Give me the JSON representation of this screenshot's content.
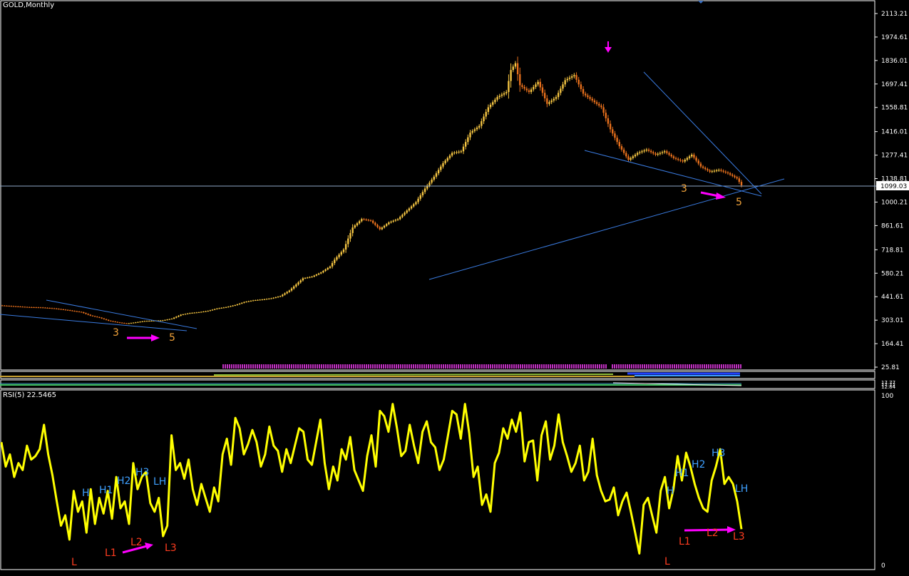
{
  "header": {
    "title": "GOLD,Monthly"
  },
  "colors": {
    "background": "#000000",
    "frame": "#ffffff",
    "bull_candle": "#f5c542",
    "bear_candle": "#e8701c",
    "trendline": "#3a7be0",
    "price_line": "#a0b8d8",
    "rsi_line": "#ffff00",
    "arrow": "#ff00ff",
    "wave_label": "#f2a33a",
    "high_label": "#3fa0ff",
    "low_label": "#ff3c1f",
    "histogram": "#c030c0"
  },
  "chart_data": [
    {
      "type": "candlestick",
      "name": "GOLD,Monthly",
      "y_ticks": [
        "2113.21",
        "1974.61",
        "1836.01",
        "1697.41",
        "1558.81",
        "1416.01",
        "1277.41",
        "1138.81",
        "1000.21",
        "861.61",
        "718.81",
        "580.21",
        "441.61",
        "303.01",
        "164.41",
        "25.81"
      ],
      "ylim": [
        25.81,
        2113.21
      ],
      "current_price_label": "1099.03",
      "current_price": 1099.03,
      "close_path": [
        [
          0,
          390
        ],
        [
          6,
          385
        ],
        [
          12,
          380
        ],
        [
          18,
          378
        ],
        [
          24,
          372
        ],
        [
          30,
          362
        ],
        [
          36,
          350
        ],
        [
          40,
          330
        ],
        [
          44,
          318
        ],
        [
          48,
          300
        ],
        [
          52,
          290
        ],
        [
          56,
          283
        ],
        [
          60,
          290
        ],
        [
          64,
          298
        ],
        [
          68,
          300
        ],
        [
          72,
          302
        ],
        [
          76,
          312
        ],
        [
          80,
          335
        ],
        [
          84,
          345
        ],
        [
          88,
          350
        ],
        [
          92,
          358
        ],
        [
          96,
          372
        ],
        [
          100,
          380
        ],
        [
          104,
          392
        ],
        [
          108,
          410
        ],
        [
          112,
          420
        ],
        [
          116,
          425
        ],
        [
          120,
          432
        ],
        [
          124,
          445
        ],
        [
          128,
          478
        ],
        [
          134,
          550
        ],
        [
          138,
          560
        ],
        [
          142,
          585
        ],
        [
          146,
          620
        ],
        [
          148,
          660
        ],
        [
          152,
          720
        ],
        [
          156,
          850
        ],
        [
          160,
          900
        ],
        [
          164,
          890
        ],
        [
          168,
          840
        ],
        [
          172,
          880
        ],
        [
          176,
          900
        ],
        [
          180,
          950
        ],
        [
          184,
          1000
        ],
        [
          188,
          1080
        ],
        [
          192,
          1150
        ],
        [
          196,
          1230
        ],
        [
          200,
          1290
        ],
        [
          204,
          1300
        ],
        [
          208,
          1410
        ],
        [
          212,
          1450
        ],
        [
          216,
          1560
        ],
        [
          220,
          1620
        ],
        [
          224,
          1650
        ],
        [
          226,
          1780
        ],
        [
          228,
          1820
        ],
        [
          230,
          1690
        ],
        [
          234,
          1650
        ],
        [
          238,
          1710
        ],
        [
          242,
          1580
        ],
        [
          246,
          1620
        ],
        [
          250,
          1720
        ],
        [
          254,
          1750
        ],
        [
          258,
          1640
        ],
        [
          262,
          1600
        ],
        [
          266,
          1560
        ],
        [
          270,
          1430
        ],
        [
          274,
          1330
        ],
        [
          278,
          1250
        ],
        [
          282,
          1290
        ],
        [
          286,
          1310
        ],
        [
          290,
          1280
        ],
        [
          294,
          1300
        ],
        [
          298,
          1260
        ],
        [
          302,
          1240
        ],
        [
          306,
          1280
        ],
        [
          310,
          1210
        ],
        [
          314,
          1180
        ],
        [
          318,
          1190
        ],
        [
          322,
          1170
        ],
        [
          326,
          1140
        ],
        [
          328,
          1099.03
        ]
      ],
      "annotations": [
        "3",
        "5",
        "3",
        "5"
      ]
    },
    {
      "type": "line",
      "name": "RSI(5) 22.5465",
      "ylim": [
        0,
        100
      ],
      "y_ticks": [
        "100",
        "0"
      ],
      "values": [
        72,
        58,
        65,
        52,
        60,
        56,
        70,
        62,
        64,
        68,
        82,
        65,
        53,
        38,
        24,
        30,
        16,
        44,
        32,
        38,
        20,
        45,
        25,
        40,
        31,
        44,
        28,
        52,
        34,
        38,
        25,
        60,
        45,
        52,
        55,
        37,
        32,
        40,
        18,
        24,
        76,
        56,
        60,
        51,
        62,
        45,
        36,
        48,
        40,
        32,
        46,
        38,
        65,
        74,
        59,
        86,
        80,
        65,
        71,
        79,
        72,
        58,
        65,
        81,
        70,
        67,
        55,
        68,
        60,
        70,
        80,
        78,
        62,
        59,
        72,
        85,
        60,
        45,
        58,
        50,
        68,
        62,
        75,
        56,
        50,
        44,
        64,
        76,
        58,
        90,
        87,
        78,
        94,
        80,
        64,
        67,
        82,
        70,
        60,
        78,
        84,
        72,
        69,
        56,
        62,
        76,
        90,
        88,
        74,
        94,
        77,
        52,
        58,
        36,
        42,
        32,
        60,
        66,
        80,
        74,
        85,
        78,
        89,
        61,
        72,
        73,
        50,
        76,
        84,
        62,
        70,
        88,
        72,
        64,
        55,
        60,
        70,
        50,
        55,
        74,
        53,
        44,
        38,
        39,
        46,
        30,
        38,
        43,
        32,
        20,
        8,
        36,
        40,
        30,
        20,
        44,
        52,
        34,
        45,
        64,
        50,
        66,
        58,
        48,
        40,
        34,
        32,
        50,
        58,
        68,
        48,
        52,
        48,
        38,
        22
      ],
      "labels_left": [
        "L",
        "H",
        "L1",
        "H1",
        "L2",
        "H2",
        "H3",
        "L3",
        "LH"
      ],
      "labels_right": [
        "L",
        "H",
        "L1",
        "H1",
        "H2",
        "L2",
        "H3",
        "L3",
        "LH"
      ]
    }
  ],
  "indicator_strip": {
    "labels": [
      "17.77",
      "17.72",
      "12.84"
    ]
  }
}
